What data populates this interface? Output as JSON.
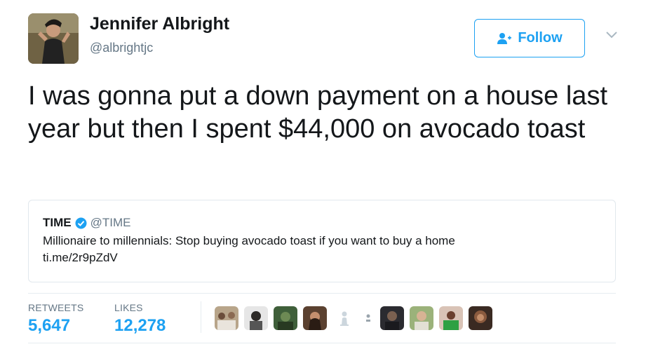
{
  "tweet": {
    "author_name": "Jennifer Albright",
    "author_handle": "@albrightjc",
    "follow_label": "Follow",
    "text": "I was gonna put a down payment on a house last year but then I spent $44,000 on avocado toast"
  },
  "quoted_tweet": {
    "author_name": "TIME",
    "author_handle": "@TIME",
    "verified": true,
    "text": "Millionaire to millennials: Stop buying avocado toast if you want to buy a home",
    "link": "ti.me/2r9pZdV"
  },
  "stats": {
    "retweets_label": "RETWEETS",
    "retweets_value": "5,647",
    "likes_label": "LIKES",
    "likes_value": "12,278"
  },
  "colors": {
    "accent": "#1da1f2",
    "secondary_text": "#657786",
    "primary_text": "#14171a",
    "border": "#e1e8ed"
  },
  "icons": {
    "follow": "add-user-icon",
    "menu": "chevron-down-icon",
    "verified": "verified-badge-icon"
  }
}
